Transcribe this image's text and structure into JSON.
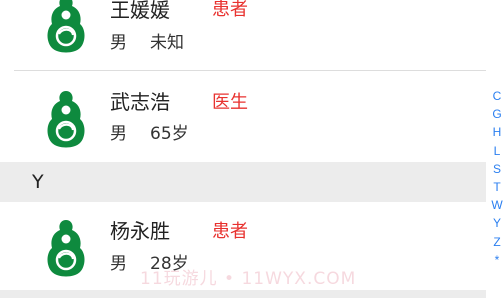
{
  "contacts": [
    {
      "name": "王媛媛",
      "role": "患者",
      "gender": "男",
      "age": "未知"
    },
    {
      "name": "武志浩",
      "role": "医生",
      "gender": "男",
      "age": "65岁"
    },
    {
      "name": "杨永胜",
      "role": "患者",
      "gender": "男",
      "age": "28岁"
    }
  ],
  "section_header": {
    "letter": "Y"
  },
  "index_bar": {
    "letters": [
      "C",
      "G",
      "H",
      "L",
      "S",
      "T",
      "W",
      "Y",
      "Z",
      "*"
    ]
  },
  "watermark": "11玩游儿 • 11WYX.COM",
  "colors": {
    "role_red": "#e8322f",
    "index_blue": "#2b7ff0",
    "logo_green": "#0e8a3e",
    "section_gray": "#ececec"
  }
}
